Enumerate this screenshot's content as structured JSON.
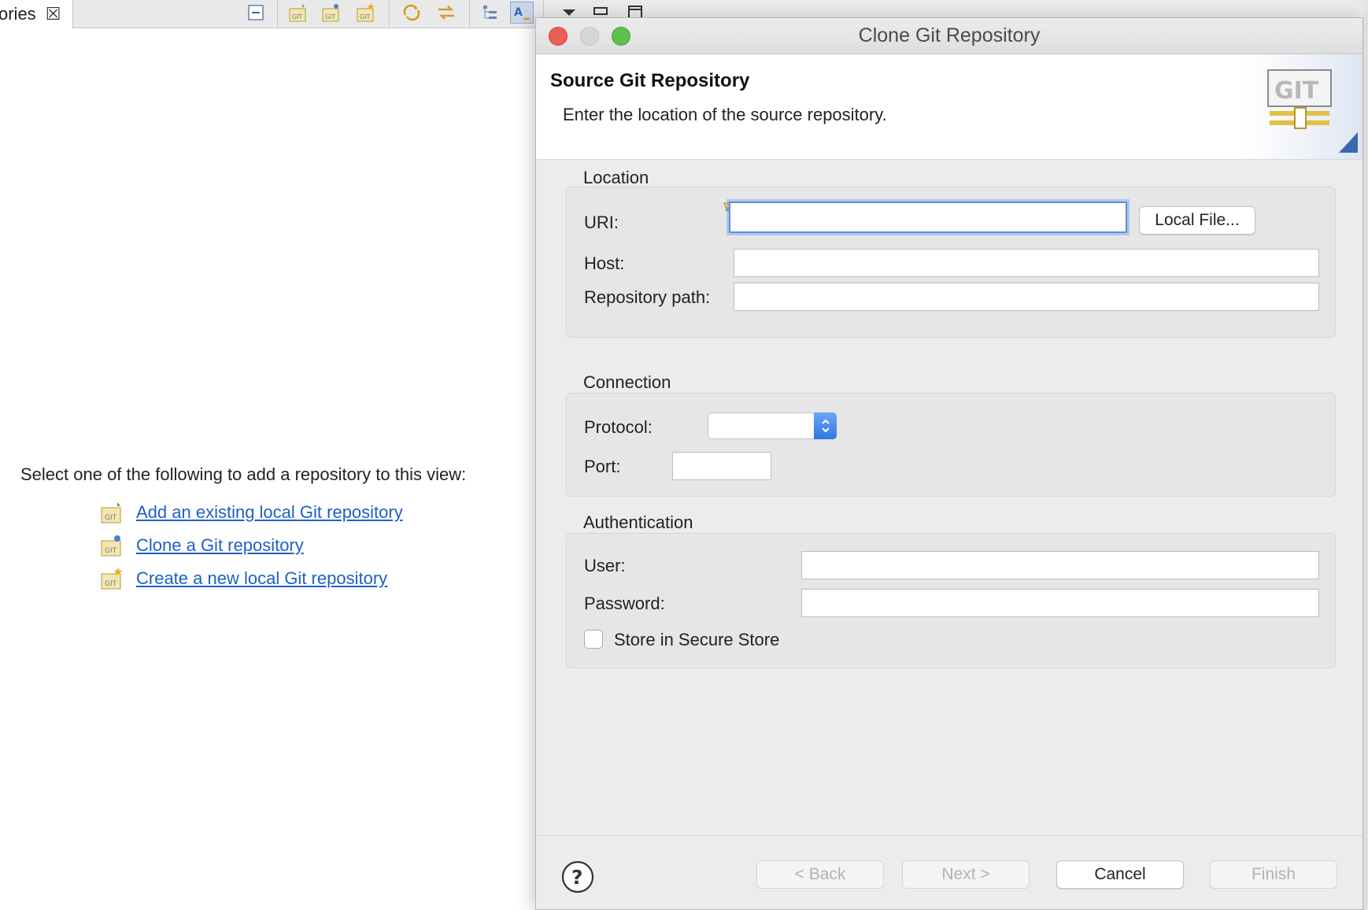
{
  "view": {
    "tab_label": "ories",
    "intro": "Select one of the following to add a repository to this view:",
    "links": [
      {
        "label": "Add an existing local Git repository"
      },
      {
        "label": "Clone a Git repository"
      },
      {
        "label": "Create a new local Git repository"
      }
    ]
  },
  "dialog": {
    "title": "Clone Git Repository",
    "header_title": "Source Git Repository",
    "header_description": "Enter the location of the source repository.",
    "git_logo": "GIT",
    "location": {
      "group_label": "Location",
      "uri_label": "URI:",
      "uri_value": "",
      "local_file_button": "Local File...",
      "host_label": "Host:",
      "host_value": "",
      "repo_path_label": "Repository path:",
      "repo_path_value": ""
    },
    "connection": {
      "group_label": "Connection",
      "protocol_label": "Protocol:",
      "protocol_value": "",
      "port_label": "Port:",
      "port_value": ""
    },
    "authentication": {
      "group_label": "Authentication",
      "user_label": "User:",
      "user_value": "",
      "password_label": "Password:",
      "password_value": "",
      "store_label": "Store in Secure Store",
      "store_checked": false
    },
    "buttons": {
      "back": "< Back",
      "next": "Next >",
      "cancel": "Cancel",
      "finish": "Finish"
    }
  },
  "colors": {
    "link": "#1f5fc5",
    "focus_ring": "#5b8fe0",
    "close": "#ec5f57",
    "maximize": "#5ebf4d"
  }
}
